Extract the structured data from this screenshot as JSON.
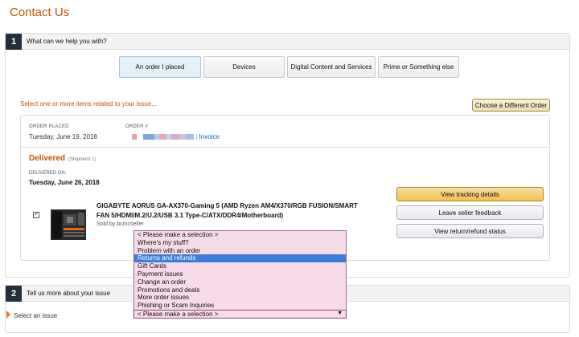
{
  "page": {
    "title": "Contact Us"
  },
  "section1": {
    "number": "1",
    "title": "What can we help you with?",
    "tabs": [
      {
        "label": "An order I placed",
        "selected": true
      },
      {
        "label": "Devices",
        "selected": false
      },
      {
        "label": "Digital Content and Services",
        "selected": false
      },
      {
        "label": "Prime or Something else",
        "selected": false
      }
    ],
    "select_hint": "Select one or more items related to your issue...",
    "different_order_button": "Choose a Different Order",
    "order": {
      "placed_label": "ORDER PLACED",
      "placed_value": "Tuesday, June 19, 2018",
      "number_label": "ORDER #",
      "invoice_link": "Invoice",
      "separator": "|",
      "status": "Delivered",
      "shipment": "(Shipment 1)",
      "delivered_on_label": "DELIVERED ON:",
      "delivered_on_value": "Tuesday, June 26, 2018",
      "item_checked": true,
      "item_title": "GIGABYTE AORUS GA-AX370-Gaming 5 (AMD Ryzen AM4/X370/RGB FUSION/SMART FAN 5/HDMI/M.2/U.2/USB 3.1 Type-C/ATX/DDR4/Motherboard)",
      "sold_by": "Sold by bcmcseller"
    },
    "actions": {
      "track": "View tracking details",
      "feedback": "Leave seller feedback",
      "return_status": "View return/refund status"
    }
  },
  "section2": {
    "number": "2",
    "title": "Tell us more about your issue",
    "issue_label": "Select an issue"
  },
  "dropdown": {
    "selected_value": "< Please make a selection >",
    "highlighted_index": 3,
    "options": [
      "< Please make a selection >",
      "Where's my stuff?",
      "Problem with an order",
      "Returns and refunds",
      "Gift Cards",
      "Payment issues",
      "Change an order",
      "Promotions and deals",
      "More order issues",
      "Phishing or Scam Inquiries"
    ],
    "arrow_icon": "▼"
  },
  "colors": {
    "accent_orange": "#c45500",
    "link_blue": "#0066c0",
    "highlight_blue": "#3b7ddd",
    "dropdown_bg": "#f8dbe8",
    "primary_button": "#f0c14b"
  }
}
